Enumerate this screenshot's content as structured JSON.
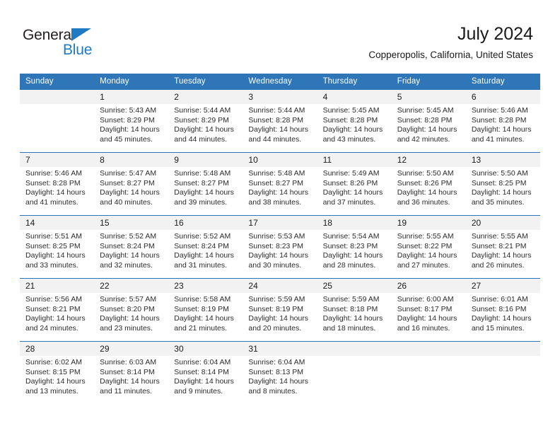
{
  "brand": {
    "name_part1": "General",
    "name_part2": "Blue",
    "triangle_icon": "triangle-icon",
    "colors": {
      "black": "#231f20",
      "blue": "#1f7ac4"
    }
  },
  "header": {
    "title": "July 2024",
    "subtitle": "Copperopolis, California, United States"
  },
  "theme": {
    "header_blue": "#2e76b8",
    "daynum_bg": "#f2f2f2",
    "text": "#1a1a1a"
  },
  "calendar": {
    "weekdays": [
      "Sunday",
      "Monday",
      "Tuesday",
      "Wednesday",
      "Thursday",
      "Friday",
      "Saturday"
    ],
    "weeks": [
      [
        {
          "day": "",
          "sunrise": "",
          "sunset": "",
          "daylight_line1": "",
          "daylight_line2": ""
        },
        {
          "day": "1",
          "sunrise": "Sunrise: 5:43 AM",
          "sunset": "Sunset: 8:29 PM",
          "daylight_line1": "Daylight: 14 hours",
          "daylight_line2": "and 45 minutes."
        },
        {
          "day": "2",
          "sunrise": "Sunrise: 5:44 AM",
          "sunset": "Sunset: 8:29 PM",
          "daylight_line1": "Daylight: 14 hours",
          "daylight_line2": "and 44 minutes."
        },
        {
          "day": "3",
          "sunrise": "Sunrise: 5:44 AM",
          "sunset": "Sunset: 8:28 PM",
          "daylight_line1": "Daylight: 14 hours",
          "daylight_line2": "and 44 minutes."
        },
        {
          "day": "4",
          "sunrise": "Sunrise: 5:45 AM",
          "sunset": "Sunset: 8:28 PM",
          "daylight_line1": "Daylight: 14 hours",
          "daylight_line2": "and 43 minutes."
        },
        {
          "day": "5",
          "sunrise": "Sunrise: 5:45 AM",
          "sunset": "Sunset: 8:28 PM",
          "daylight_line1": "Daylight: 14 hours",
          "daylight_line2": "and 42 minutes."
        },
        {
          "day": "6",
          "sunrise": "Sunrise: 5:46 AM",
          "sunset": "Sunset: 8:28 PM",
          "daylight_line1": "Daylight: 14 hours",
          "daylight_line2": "and 41 minutes."
        }
      ],
      [
        {
          "day": "7",
          "sunrise": "Sunrise: 5:46 AM",
          "sunset": "Sunset: 8:28 PM",
          "daylight_line1": "Daylight: 14 hours",
          "daylight_line2": "and 41 minutes."
        },
        {
          "day": "8",
          "sunrise": "Sunrise: 5:47 AM",
          "sunset": "Sunset: 8:27 PM",
          "daylight_line1": "Daylight: 14 hours",
          "daylight_line2": "and 40 minutes."
        },
        {
          "day": "9",
          "sunrise": "Sunrise: 5:48 AM",
          "sunset": "Sunset: 8:27 PM",
          "daylight_line1": "Daylight: 14 hours",
          "daylight_line2": "and 39 minutes."
        },
        {
          "day": "10",
          "sunrise": "Sunrise: 5:48 AM",
          "sunset": "Sunset: 8:27 PM",
          "daylight_line1": "Daylight: 14 hours",
          "daylight_line2": "and 38 minutes."
        },
        {
          "day": "11",
          "sunrise": "Sunrise: 5:49 AM",
          "sunset": "Sunset: 8:26 PM",
          "daylight_line1": "Daylight: 14 hours",
          "daylight_line2": "and 37 minutes."
        },
        {
          "day": "12",
          "sunrise": "Sunrise: 5:50 AM",
          "sunset": "Sunset: 8:26 PM",
          "daylight_line1": "Daylight: 14 hours",
          "daylight_line2": "and 36 minutes."
        },
        {
          "day": "13",
          "sunrise": "Sunrise: 5:50 AM",
          "sunset": "Sunset: 8:25 PM",
          "daylight_line1": "Daylight: 14 hours",
          "daylight_line2": "and 35 minutes."
        }
      ],
      [
        {
          "day": "14",
          "sunrise": "Sunrise: 5:51 AM",
          "sunset": "Sunset: 8:25 PM",
          "daylight_line1": "Daylight: 14 hours",
          "daylight_line2": "and 33 minutes."
        },
        {
          "day": "15",
          "sunrise": "Sunrise: 5:52 AM",
          "sunset": "Sunset: 8:24 PM",
          "daylight_line1": "Daylight: 14 hours",
          "daylight_line2": "and 32 minutes."
        },
        {
          "day": "16",
          "sunrise": "Sunrise: 5:52 AM",
          "sunset": "Sunset: 8:24 PM",
          "daylight_line1": "Daylight: 14 hours",
          "daylight_line2": "and 31 minutes."
        },
        {
          "day": "17",
          "sunrise": "Sunrise: 5:53 AM",
          "sunset": "Sunset: 8:23 PM",
          "daylight_line1": "Daylight: 14 hours",
          "daylight_line2": "and 30 minutes."
        },
        {
          "day": "18",
          "sunrise": "Sunrise: 5:54 AM",
          "sunset": "Sunset: 8:23 PM",
          "daylight_line1": "Daylight: 14 hours",
          "daylight_line2": "and 28 minutes."
        },
        {
          "day": "19",
          "sunrise": "Sunrise: 5:55 AM",
          "sunset": "Sunset: 8:22 PM",
          "daylight_line1": "Daylight: 14 hours",
          "daylight_line2": "and 27 minutes."
        },
        {
          "day": "20",
          "sunrise": "Sunrise: 5:55 AM",
          "sunset": "Sunset: 8:21 PM",
          "daylight_line1": "Daylight: 14 hours",
          "daylight_line2": "and 26 minutes."
        }
      ],
      [
        {
          "day": "21",
          "sunrise": "Sunrise: 5:56 AM",
          "sunset": "Sunset: 8:21 PM",
          "daylight_line1": "Daylight: 14 hours",
          "daylight_line2": "and 24 minutes."
        },
        {
          "day": "22",
          "sunrise": "Sunrise: 5:57 AM",
          "sunset": "Sunset: 8:20 PM",
          "daylight_line1": "Daylight: 14 hours",
          "daylight_line2": "and 23 minutes."
        },
        {
          "day": "23",
          "sunrise": "Sunrise: 5:58 AM",
          "sunset": "Sunset: 8:19 PM",
          "daylight_line1": "Daylight: 14 hours",
          "daylight_line2": "and 21 minutes."
        },
        {
          "day": "24",
          "sunrise": "Sunrise: 5:59 AM",
          "sunset": "Sunset: 8:19 PM",
          "daylight_line1": "Daylight: 14 hours",
          "daylight_line2": "and 20 minutes."
        },
        {
          "day": "25",
          "sunrise": "Sunrise: 5:59 AM",
          "sunset": "Sunset: 8:18 PM",
          "daylight_line1": "Daylight: 14 hours",
          "daylight_line2": "and 18 minutes."
        },
        {
          "day": "26",
          "sunrise": "Sunrise: 6:00 AM",
          "sunset": "Sunset: 8:17 PM",
          "daylight_line1": "Daylight: 14 hours",
          "daylight_line2": "and 16 minutes."
        },
        {
          "day": "27",
          "sunrise": "Sunrise: 6:01 AM",
          "sunset": "Sunset: 8:16 PM",
          "daylight_line1": "Daylight: 14 hours",
          "daylight_line2": "and 15 minutes."
        }
      ],
      [
        {
          "day": "28",
          "sunrise": "Sunrise: 6:02 AM",
          "sunset": "Sunset: 8:15 PM",
          "daylight_line1": "Daylight: 14 hours",
          "daylight_line2": "and 13 minutes."
        },
        {
          "day": "29",
          "sunrise": "Sunrise: 6:03 AM",
          "sunset": "Sunset: 8:14 PM",
          "daylight_line1": "Daylight: 14 hours",
          "daylight_line2": "and 11 minutes."
        },
        {
          "day": "30",
          "sunrise": "Sunrise: 6:04 AM",
          "sunset": "Sunset: 8:14 PM",
          "daylight_line1": "Daylight: 14 hours",
          "daylight_line2": "and 9 minutes."
        },
        {
          "day": "31",
          "sunrise": "Sunrise: 6:04 AM",
          "sunset": "Sunset: 8:13 PM",
          "daylight_line1": "Daylight: 14 hours",
          "daylight_line2": "and 8 minutes."
        },
        {
          "day": "",
          "sunrise": "",
          "sunset": "",
          "daylight_line1": "",
          "daylight_line2": ""
        },
        {
          "day": "",
          "sunrise": "",
          "sunset": "",
          "daylight_line1": "",
          "daylight_line2": ""
        },
        {
          "day": "",
          "sunrise": "",
          "sunset": "",
          "daylight_line1": "",
          "daylight_line2": ""
        }
      ]
    ]
  }
}
